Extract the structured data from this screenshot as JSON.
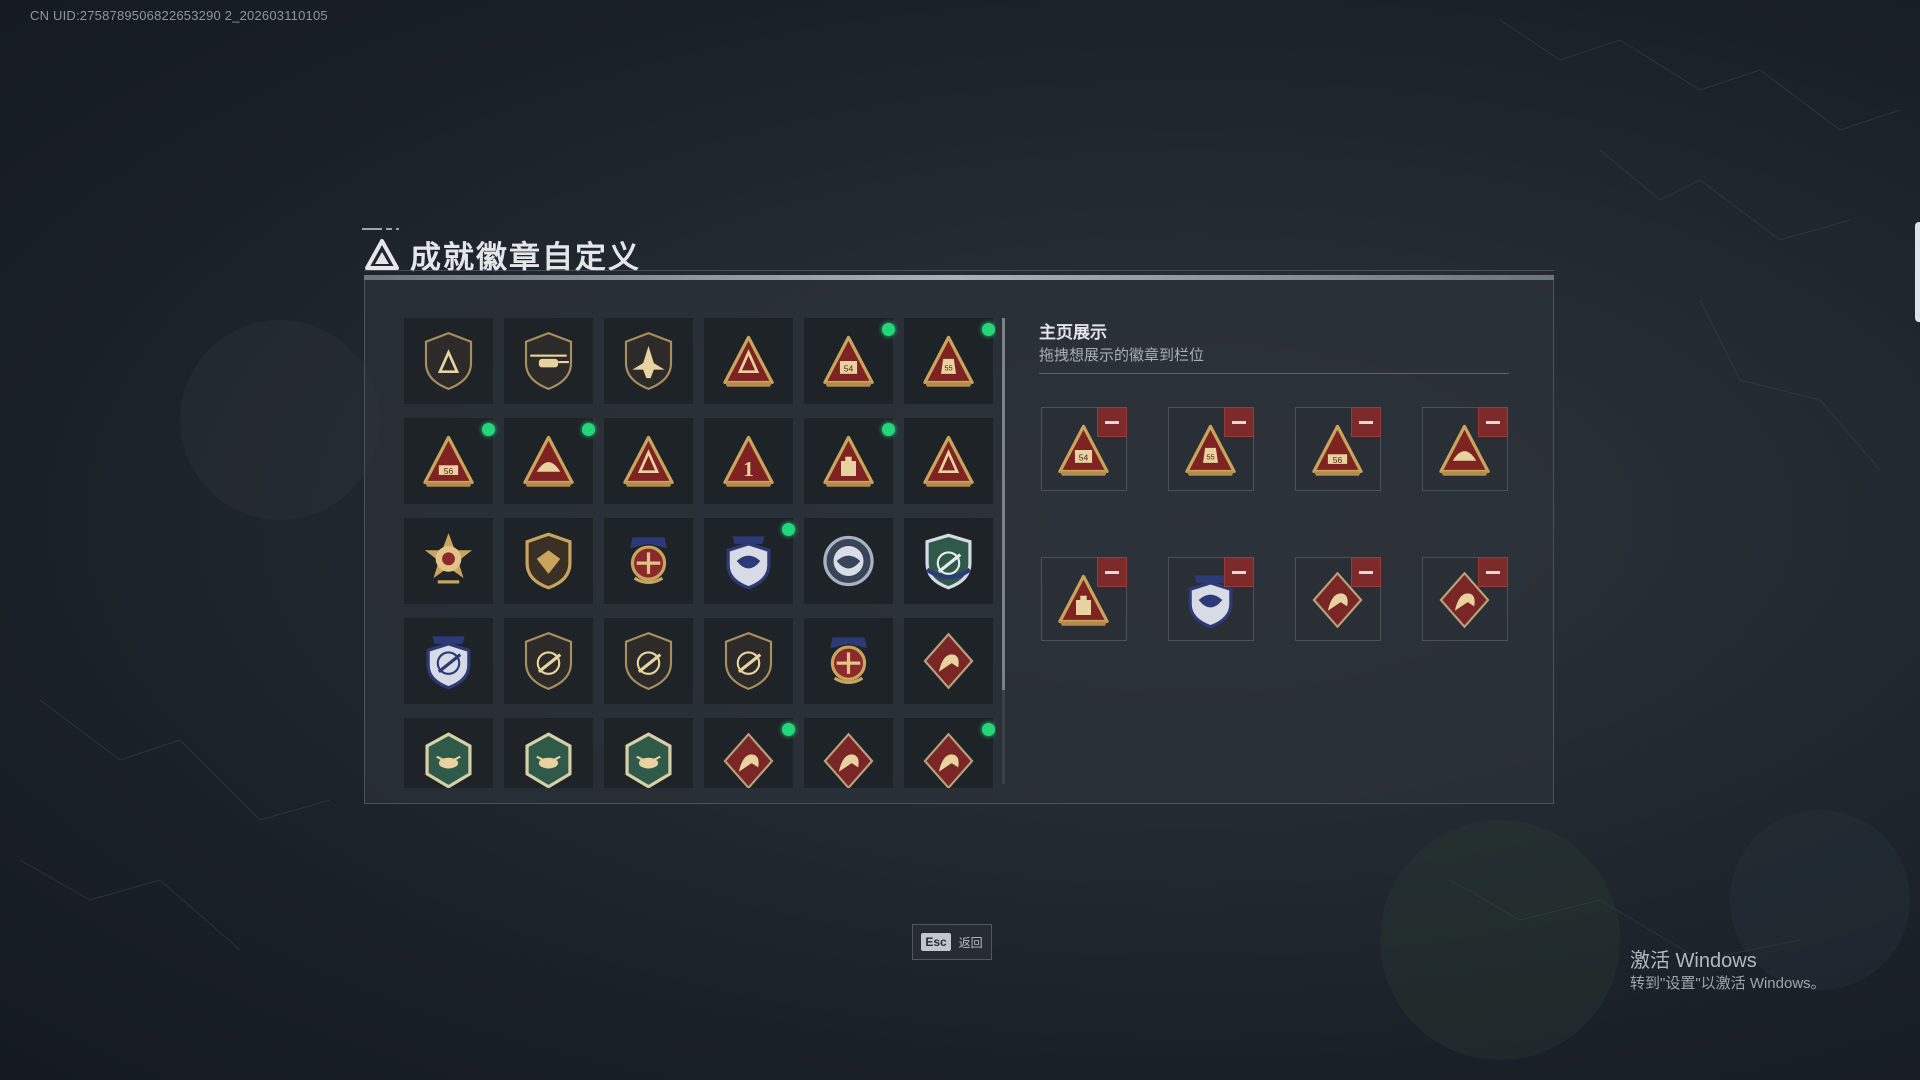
{
  "uid": "CN UID:2758789506822653290 2_202603110105",
  "title": "成就徽章自定义",
  "side": {
    "title": "主页展示",
    "subtitle": "拖拽想展示的徽章到栏位"
  },
  "esc": {
    "key": "Esc",
    "label": "返回"
  },
  "watermark": {
    "line1": "激活 Windows",
    "line2": "转到\"设置\"以激活 Windows。"
  },
  "colors": {
    "badge_gold": "#c9a45c",
    "badge_red": "#8a2323",
    "badge_blue": "#2d3a78",
    "badge_green": "#2f5a4a",
    "badge_maroon": "#7a2626",
    "new_dot": "#22d67a",
    "remove_red": "#7d2a2a"
  },
  "badges": [
    {
      "icon": "shield-triangle-badge-icon",
      "style": "dark-shield",
      "new": false
    },
    {
      "icon": "helicopter-badge-icon",
      "style": "dark-shield",
      "new": false
    },
    {
      "icon": "jet-badge-icon",
      "style": "dark-shield",
      "new": false
    },
    {
      "icon": "tripod-triangle-badge-icon",
      "style": "red-triangle",
      "new": false
    },
    {
      "icon": "map-54-triangle-badge-icon",
      "style": "red-triangle",
      "new": true
    },
    {
      "icon": "bag-55-triangle-badge-icon",
      "style": "red-triangle",
      "new": true
    },
    {
      "icon": "shoes-56-triangle-badge-icon",
      "style": "red-triangle",
      "new": true
    },
    {
      "icon": "helmet-triangle-badge-icon",
      "style": "red-triangle",
      "new": true
    },
    {
      "icon": "prone-soldier-triangle-badge-icon",
      "style": "red-triangle",
      "new": false
    },
    {
      "icon": "number-1-triangle-badge-icon",
      "style": "red-triangle",
      "new": false
    },
    {
      "icon": "supply-crate-triangle-badge-icon",
      "style": "red-triangle",
      "new": true
    },
    {
      "icon": "soldiers-triangle-badge-icon",
      "style": "red-triangle",
      "new": false
    },
    {
      "icon": "star-medal-badge-icon",
      "style": "gold-star",
      "new": false
    },
    {
      "icon": "wings-shield-badge-icon",
      "style": "gold-shield",
      "new": false
    },
    {
      "icon": "crest-shield-badge-icon",
      "style": "gold-crest",
      "new": false
    },
    {
      "icon": "eagle-blue-shield-badge-icon",
      "style": "blue-shield",
      "new": true
    },
    {
      "icon": "eagle-round-badge-icon",
      "style": "silver-round",
      "new": false
    },
    {
      "icon": "crosshair-green-shield-badge-icon",
      "style": "green-shield",
      "new": false
    },
    {
      "icon": "crosshair-blue-shield-badge-icon",
      "style": "blue-shield",
      "new": false
    },
    {
      "icon": "rifle-shield-badge-icon",
      "style": "dark-shield",
      "new": false
    },
    {
      "icon": "rifle-shield-badge-icon",
      "style": "dark-shield",
      "new": false
    },
    {
      "icon": "rifle-shield-badge-icon",
      "style": "dark-shield",
      "new": false
    },
    {
      "icon": "crossed-guns-gold-badge-icon",
      "style": "gold-crest",
      "new": false
    },
    {
      "icon": "wolf-diamond-badge-icon",
      "style": "maroon-diamond",
      "new": false
    },
    {
      "icon": "wasp-green-hex-badge-icon",
      "style": "green-hex",
      "new": false
    },
    {
      "icon": "wasp-green-hex-badge-icon",
      "style": "green-hex",
      "new": false
    },
    {
      "icon": "drone-green-hex-badge-icon",
      "style": "green-hex",
      "new": false
    },
    {
      "icon": "dragon-diamond-badge-icon",
      "style": "maroon-diamond",
      "new": true
    },
    {
      "icon": "dragon-diamond-badge-icon",
      "style": "maroon-diamond",
      "new": false
    },
    {
      "icon": "runner-diamond-badge-icon",
      "style": "maroon-diamond",
      "new": true
    }
  ],
  "slots": [
    {
      "icon": "map-54-triangle-badge-icon",
      "style": "red-triangle"
    },
    {
      "icon": "bag-55-triangle-badge-icon",
      "style": "red-triangle"
    },
    {
      "icon": "shoes-56-triangle-badge-icon",
      "style": "red-triangle"
    },
    {
      "icon": "helmet-triangle-badge-icon",
      "style": "red-triangle"
    },
    {
      "icon": "supply-crate-triangle-badge-icon",
      "style": "red-triangle"
    },
    {
      "icon": "eagle-blue-shield-badge-icon",
      "style": "blue-shield"
    },
    {
      "icon": "runner-diamond-badge-icon",
      "style": "maroon-diamond"
    },
    {
      "icon": "dragon-diamond-badge-icon",
      "style": "maroon-diamond"
    }
  ]
}
